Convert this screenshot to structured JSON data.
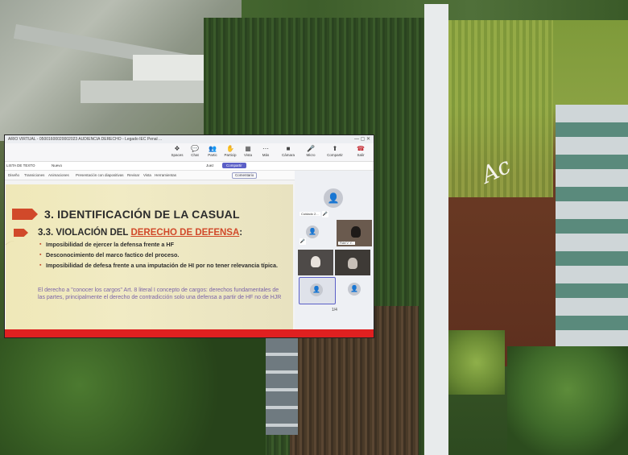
{
  "window": {
    "title": "ARIO VIRTUAL - 05001600020002023 AUDIENCIA DERECHO - Legado IEC Penal ...",
    "controls": "—  ▢  ✕"
  },
  "toolbar": {
    "timer": "",
    "items": [
      {
        "label": "Spaces",
        "icon": "spaces-icon",
        "glyph": "❖"
      },
      {
        "label": "Chat",
        "icon": "chat-icon",
        "glyph": "💬"
      },
      {
        "label": "Partic",
        "icon": "participants-icon",
        "glyph": "👥"
      },
      {
        "label": "Particip",
        "icon": "raise-hand-icon",
        "glyph": "✋"
      },
      {
        "label": "Vista",
        "icon": "view-icon",
        "glyph": "▦"
      },
      {
        "label": "Más",
        "icon": "more-icon",
        "glyph": "⋯"
      },
      {
        "label": "Cámara",
        "icon": "camera-icon",
        "glyph": "■"
      },
      {
        "label": "Micro",
        "icon": "microphone-icon",
        "glyph": "🎤"
      },
      {
        "label": "Compartir",
        "icon": "share-icon",
        "glyph": "⬆"
      },
      {
        "label": "Salir",
        "icon": "leave-icon",
        "glyph": "☎"
      }
    ]
  },
  "ribbon": {
    "left": "LISTA DE TEXTO",
    "mid": "Nuevo",
    "share": "Compartir",
    "user": "Juez"
  },
  "menu": {
    "items": [
      "Diseño",
      "Transiciones",
      "Animaciones",
      "Presentación con diapositivas",
      "Revisar",
      "Vista",
      "Herramientas"
    ],
    "comment": "Comentario"
  },
  "slide": {
    "title": "3. IDENTIFICACIÓN DE LA CASUAL",
    "subtitle_prefix": "3.3. VIOLACIÓN DEL ",
    "subtitle_highlight": "DERECHO DE DEFENSA",
    "subtitle_suffix": ":",
    "bullets": [
      "Imposibilidad de ejercer la defensa frente a HF",
      "Desconocimiento del marco factico del proceso.",
      "Imposibilidad de defesa frente a una imputación de HI por no tener relevancia típica."
    ],
    "note": "El derecho a \"conocer los cargos\" Art. 8 literal I concepto de cargos: derechos fundamentales de las partes, principalmente el derecho de contradicción solo una defensa a partir de HF no de HJR"
  },
  "panel": {
    "name_tag_1": "Cuidado 2...",
    "name_tag_2": "Fidel V. Y...",
    "pager": "1/4"
  }
}
